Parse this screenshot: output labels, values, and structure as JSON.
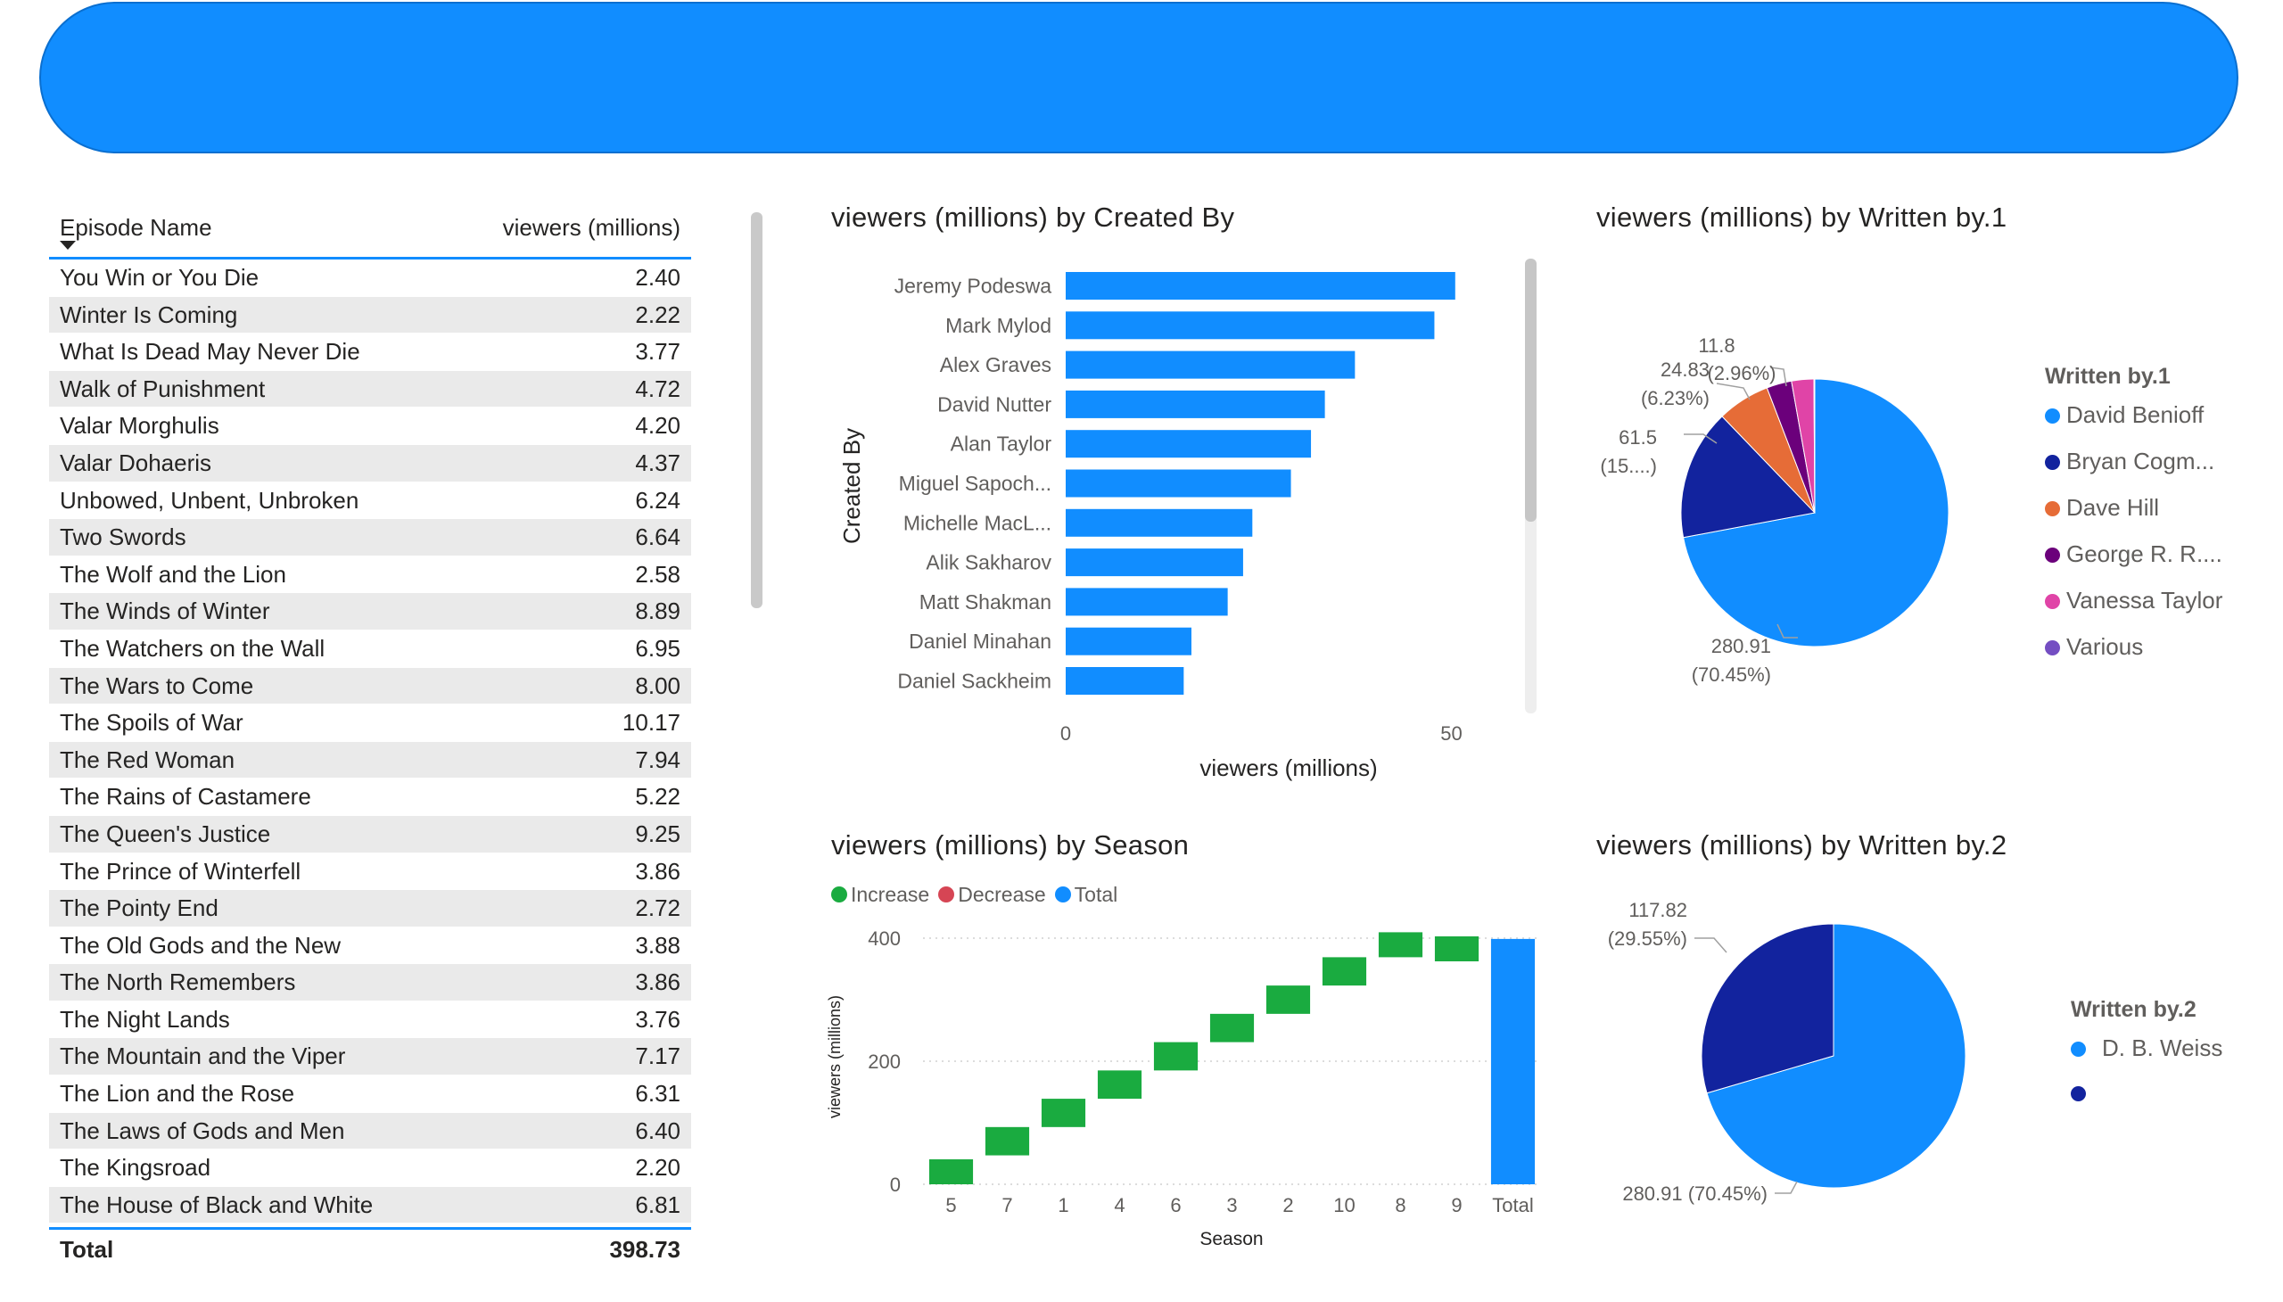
{
  "table": {
    "headers": [
      "Episode Name",
      "viewers (millions)"
    ],
    "rows": [
      [
        "You Win or You Die",
        "2.40"
      ],
      [
        "Winter Is Coming",
        "2.22"
      ],
      [
        "What Is Dead May Never Die",
        "3.77"
      ],
      [
        "Walk of Punishment",
        "4.72"
      ],
      [
        "Valar Morghulis",
        "4.20"
      ],
      [
        "Valar Dohaeris",
        "4.37"
      ],
      [
        "Unbowed, Unbent, Unbroken",
        "6.24"
      ],
      [
        "Two Swords",
        "6.64"
      ],
      [
        "The Wolf and the Lion",
        "2.58"
      ],
      [
        "The Winds of Winter",
        "8.89"
      ],
      [
        "The Watchers on the Wall",
        "6.95"
      ],
      [
        "The Wars to Come",
        "8.00"
      ],
      [
        "The Spoils of War",
        "10.17"
      ],
      [
        "The Red Woman",
        "7.94"
      ],
      [
        "The Rains of Castamere",
        "5.22"
      ],
      [
        "The Queen's Justice",
        "9.25"
      ],
      [
        "The Prince of Winterfell",
        "3.86"
      ],
      [
        "The Pointy End",
        "2.72"
      ],
      [
        "The Old Gods and the New",
        "3.88"
      ],
      [
        "The North Remembers",
        "3.86"
      ],
      [
        "The Night Lands",
        "3.76"
      ],
      [
        "The Mountain and the Viper",
        "7.17"
      ],
      [
        "The Lion and the Rose",
        "6.31"
      ],
      [
        "The Laws of Gods and Men",
        "6.40"
      ],
      [
        "The Kingsroad",
        "2.20"
      ],
      [
        "The House of Black and White",
        "6.81"
      ]
    ],
    "total_label": "Total",
    "total_value": "398.73"
  },
  "chart_data": [
    {
      "type": "bar",
      "orientation": "horizontal",
      "title": "viewers (millions) by Created By",
      "xlabel": "viewers (millions)",
      "ylabel": "Created By",
      "categories": [
        "Jeremy Podeswa",
        "Mark Mylod",
        "Alex Graves",
        "David Nutter",
        "Alan Taylor",
        "Miguel Sapoch...",
        "Michelle MacL...",
        "Alik Sakharov",
        "Matt Shakman",
        "Daniel Minahan",
        "Daniel Sackheim"
      ],
      "values": [
        50.5,
        47.8,
        37.5,
        33.6,
        31.8,
        29.2,
        24.2,
        23.0,
        21.0,
        16.3,
        15.3
      ],
      "xlim": [
        0,
        57
      ],
      "xticks": [
        "0",
        "50"
      ],
      "color": "#118DFF"
    },
    {
      "type": "pie",
      "title": "viewers (millions) by Written by.1",
      "legend_title": "Written by.1",
      "slices": [
        {
          "name": "David Benioff",
          "value": 280.91,
          "color": "#118DFF",
          "label": "280.91",
          "pct": "(70.45%)"
        },
        {
          "name": "Bryan Cogm...",
          "value": 61.5,
          "color": "#12239E",
          "label": "61.5",
          "pct": "(15....)"
        },
        {
          "name": "Dave Hill",
          "value": 24.83,
          "color": "#E66C37",
          "label": "24.83",
          "pct": "(6.23%)"
        },
        {
          "name": "George R. R....",
          "value": 11.8,
          "color": "#6B007B",
          "label": "11.8",
          "pct": "(2.96%)"
        },
        {
          "name": "Vanessa Taylor",
          "value": 10.5,
          "color": "#E044A7",
          "label": "",
          "pct": ""
        },
        {
          "name": "Various",
          "value": 0.4,
          "color": "#744EC2",
          "label": "",
          "pct": ""
        }
      ]
    },
    {
      "type": "waterfall",
      "title": "viewers (millions) by Season",
      "xlabel": "Season",
      "ylabel": "viewers (millions)",
      "legend": [
        {
          "name": "Increase",
          "color": "#1AAB40"
        },
        {
          "name": "Decrease",
          "color": "#D64554"
        },
        {
          "name": "Total",
          "color": "#118DFF"
        }
      ],
      "categories": [
        "5",
        "7",
        "1",
        "4",
        "6",
        "3",
        "2",
        "10",
        "8",
        "9"
      ],
      "cumulative": [
        0,
        47,
        93,
        139,
        185,
        231,
        277,
        323,
        369,
        398.73
      ],
      "deltas": [
        47,
        46,
        46,
        46,
        46,
        46,
        46,
        46,
        29.73,
        0
      ],
      "total_label": "Total",
      "total": 398.73,
      "ylim": [
        0,
        400
      ],
      "yticks": [
        0,
        200,
        400
      ]
    },
    {
      "type": "pie",
      "title": "viewers (millions) by Written by.2",
      "legend_title": "Written by.2",
      "slices": [
        {
          "name": "D. B. Weiss",
          "value": 280.91,
          "color": "#118DFF",
          "label": "280.91 (70.45%)"
        },
        {
          "name": "",
          "value": 117.82,
          "color": "#12239E",
          "label": "117.82",
          "pct": "(29.55%)"
        }
      ]
    }
  ]
}
